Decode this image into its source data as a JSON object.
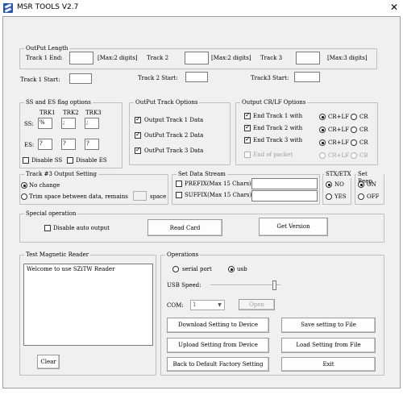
{
  "window": {
    "title": "MSR TOOLS V2.7",
    "close": "✕"
  },
  "output_length": {
    "title": "OutPut Length",
    "track1_end": "Track 1 End:",
    "track1_hint": "[Max:2 digits]",
    "track2": "Track 2",
    "track2_hint": "[Max:2 digits]",
    "track3": "Track 3",
    "track3_hint": "[Max:3 digits]"
  },
  "starts": {
    "track1": "Track 1 Start:",
    "track2": "Track 2 Start:",
    "track3": "Track3 Start:"
  },
  "ss_es": {
    "title": "SS and ES flag options",
    "trk1": "TRK1",
    "trk2": "TRK2",
    "trk3": "TRK3",
    "ss_label": "SS:",
    "es_label": "ES:",
    "ss_values": [
      "%",
      ";",
      ";"
    ],
    "es_values": [
      "?",
      "?",
      "?"
    ],
    "disable_ss": "Disable SS",
    "disable_es": "Disable ES"
  },
  "output_track": {
    "title": "OutPut Track Options",
    "items": [
      "Output Track 1 Data",
      "OutPut Track 2 Data",
      "OutPut Track 3 Data"
    ]
  },
  "crlf": {
    "title": "Output CR/LF Options",
    "rows": [
      "End Track 1 with",
      "End Track 2 with",
      "End Track 3 with",
      "End of packet"
    ],
    "opt1": "CR+LF",
    "opt2": "CR"
  },
  "track3_setting": {
    "title": "Track #3 Output Setting",
    "no_change": "No change",
    "trim": "Trim space between data, remains",
    "space": "space"
  },
  "data_stream": {
    "title": "Set Data Stream",
    "prefix": "PREFIX(Max 15 Chars):",
    "suffix": "SUFFIX(Max 15 Chars):"
  },
  "stx": {
    "title": "STX/ETX",
    "no": "NO",
    "yes": "YES"
  },
  "beep": {
    "title": "Set Beep",
    "on": "ON",
    "off": "OFF"
  },
  "special": {
    "title": "Special operation",
    "auto_output": "Disable auto output",
    "read_card": "Read Card",
    "get_version": "Get Version"
  },
  "reader": {
    "title": "Test Magnetic Reader",
    "text": "Welcome to use SZiTW Reader",
    "clear": "Clear"
  },
  "operations": {
    "title": "Operations",
    "serial": "serial port",
    "usb": "usb",
    "usb_speed": "USB Speed:",
    "usb_speed_level": 0.95,
    "com": "COM:",
    "com_value": "1",
    "open": "Open",
    "download": "Download Setting to Device",
    "save_file": "Save setting to File",
    "upload": "Upload Setting from Device",
    "load_file": "Load Setting from File",
    "factory": "Back to Default Factory Setting",
    "exit": "Exit"
  }
}
